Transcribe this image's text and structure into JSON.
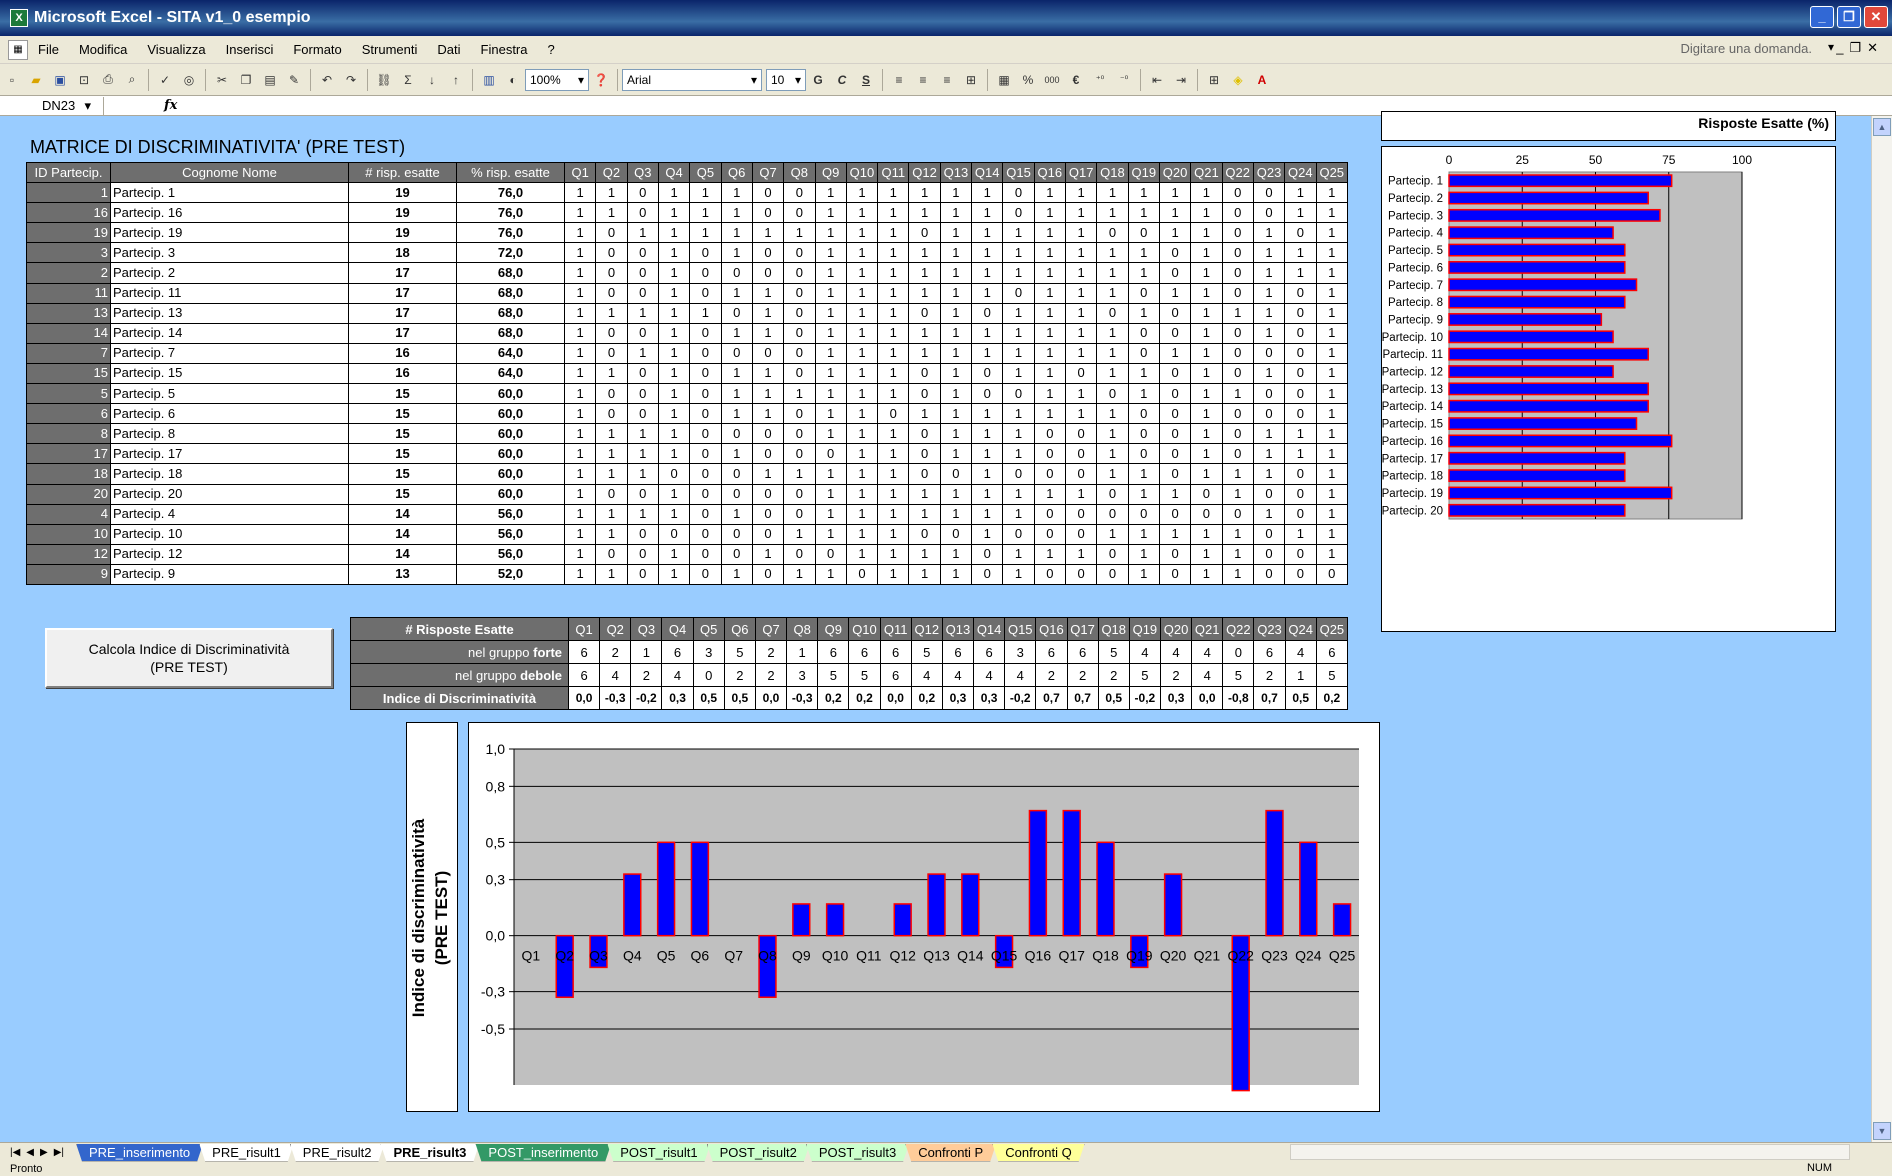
{
  "window": {
    "title": "Microsoft Excel - SITA v1_0 esempio",
    "help_placeholder": "Digitare una domanda."
  },
  "menu": [
    "File",
    "Modifica",
    "Visualizza",
    "Inserisci",
    "Formato",
    "Strumenti",
    "Dati",
    "Finestra",
    "?"
  ],
  "toolbar": {
    "zoom": "100%",
    "font": "Arial",
    "size": "10",
    "bold": "G",
    "italic": "C",
    "underline": "S",
    "percent": "%",
    "thousands": "000",
    "euro": "€"
  },
  "formula": {
    "cell_ref": "DN23",
    "fx": "fx",
    "value": ""
  },
  "sheet_title": "MATRICE DI DISCRIMINATIVITA' (PRE TEST)",
  "matrix": {
    "headers": [
      "ID Partecip.",
      "Cognome Nome",
      "# risp. esatte",
      "% risp. esatte",
      "Q1",
      "Q2",
      "Q3",
      "Q4",
      "Q5",
      "Q6",
      "Q7",
      "Q8",
      "Q9",
      "Q10",
      "Q11",
      "Q12",
      "Q13",
      "Q14",
      "Q15",
      "Q16",
      "Q17",
      "Q18",
      "Q19",
      "Q20",
      "Q21",
      "Q22",
      "Q23",
      "Q24",
      "Q25"
    ],
    "rows": [
      {
        "id": "1",
        "name": "Partecip. 1",
        "n": "19",
        "pct": "76,0",
        "q": [
          1,
          1,
          0,
          1,
          1,
          1,
          0,
          0,
          1,
          1,
          1,
          1,
          1,
          1,
          0,
          1,
          1,
          1,
          1,
          1,
          1,
          0,
          0,
          1,
          1
        ]
      },
      {
        "id": "16",
        "name": "Partecip. 16",
        "n": "19",
        "pct": "76,0",
        "q": [
          1,
          1,
          0,
          1,
          1,
          1,
          0,
          0,
          1,
          1,
          1,
          1,
          1,
          1,
          0,
          1,
          1,
          1,
          1,
          1,
          1,
          0,
          0,
          1,
          1
        ]
      },
      {
        "id": "19",
        "name": "Partecip. 19",
        "n": "19",
        "pct": "76,0",
        "q": [
          1,
          0,
          1,
          1,
          1,
          1,
          1,
          1,
          1,
          1,
          1,
          0,
          1,
          1,
          1,
          1,
          1,
          0,
          0,
          1,
          1,
          0,
          1,
          0,
          1
        ]
      },
      {
        "id": "3",
        "name": "Partecip. 3",
        "n": "18",
        "pct": "72,0",
        "q": [
          1,
          0,
          0,
          1,
          0,
          1,
          0,
          0,
          1,
          1,
          1,
          1,
          1,
          1,
          1,
          1,
          1,
          1,
          1,
          0,
          1,
          0,
          1,
          1,
          1
        ]
      },
      {
        "id": "2",
        "name": "Partecip. 2",
        "n": "17",
        "pct": "68,0",
        "q": [
          1,
          0,
          0,
          1,
          0,
          0,
          0,
          0,
          1,
          1,
          1,
          1,
          1,
          1,
          1,
          1,
          1,
          1,
          1,
          0,
          1,
          0,
          1,
          1,
          1
        ]
      },
      {
        "id": "11",
        "name": "Partecip. 11",
        "n": "17",
        "pct": "68,0",
        "q": [
          1,
          0,
          0,
          1,
          0,
          1,
          1,
          0,
          1,
          1,
          1,
          1,
          1,
          1,
          0,
          1,
          1,
          1,
          0,
          1,
          1,
          0,
          1,
          0,
          1
        ]
      },
      {
        "id": "13",
        "name": "Partecip. 13",
        "n": "17",
        "pct": "68,0",
        "q": [
          1,
          1,
          1,
          1,
          1,
          0,
          1,
          0,
          1,
          1,
          1,
          0,
          1,
          0,
          1,
          1,
          1,
          0,
          1,
          0,
          1,
          1,
          1,
          0,
          1
        ]
      },
      {
        "id": "14",
        "name": "Partecip. 14",
        "n": "17",
        "pct": "68,0",
        "q": [
          1,
          0,
          0,
          1,
          0,
          1,
          1,
          0,
          1,
          1,
          1,
          1,
          1,
          1,
          1,
          1,
          1,
          1,
          0,
          0,
          1,
          0,
          1,
          0,
          1
        ]
      },
      {
        "id": "7",
        "name": "Partecip. 7",
        "n": "16",
        "pct": "64,0",
        "q": [
          1,
          0,
          1,
          1,
          0,
          0,
          0,
          0,
          1,
          1,
          1,
          1,
          1,
          1,
          1,
          1,
          1,
          1,
          0,
          1,
          1,
          0,
          0,
          0,
          1
        ]
      },
      {
        "id": "15",
        "name": "Partecip. 15",
        "n": "16",
        "pct": "64,0",
        "q": [
          1,
          1,
          0,
          1,
          0,
          1,
          1,
          0,
          1,
          1,
          1,
          0,
          1,
          0,
          1,
          1,
          0,
          1,
          1,
          0,
          1,
          0,
          1,
          0,
          1
        ]
      },
      {
        "id": "5",
        "name": "Partecip. 5",
        "n": "15",
        "pct": "60,0",
        "q": [
          1,
          0,
          0,
          1,
          0,
          1,
          1,
          1,
          1,
          1,
          1,
          0,
          1,
          0,
          0,
          1,
          1,
          0,
          1,
          0,
          1,
          1,
          0,
          0,
          1
        ]
      },
      {
        "id": "6",
        "name": "Partecip. 6",
        "n": "15",
        "pct": "60,0",
        "q": [
          1,
          0,
          0,
          1,
          0,
          1,
          1,
          0,
          1,
          1,
          0,
          1,
          1,
          1,
          1,
          1,
          1,
          1,
          0,
          0,
          1,
          0,
          0,
          0,
          1
        ]
      },
      {
        "id": "8",
        "name": "Partecip. 8",
        "n": "15",
        "pct": "60,0",
        "q": [
          1,
          1,
          1,
          1,
          0,
          0,
          0,
          0,
          1,
          1,
          1,
          0,
          1,
          1,
          1,
          0,
          0,
          1,
          0,
          0,
          1,
          0,
          1,
          1,
          1
        ]
      },
      {
        "id": "17",
        "name": "Partecip. 17",
        "n": "15",
        "pct": "60,0",
        "q": [
          1,
          1,
          1,
          1,
          0,
          1,
          0,
          0,
          0,
          1,
          1,
          0,
          1,
          1,
          1,
          0,
          0,
          1,
          0,
          0,
          1,
          0,
          1,
          1,
          1
        ]
      },
      {
        "id": "18",
        "name": "Partecip. 18",
        "n": "15",
        "pct": "60,0",
        "q": [
          1,
          1,
          1,
          0,
          0,
          0,
          1,
          1,
          1,
          1,
          1,
          0,
          0,
          1,
          0,
          0,
          0,
          1,
          1,
          0,
          1,
          1,
          1,
          0,
          1
        ]
      },
      {
        "id": "20",
        "name": "Partecip. 20",
        "n": "15",
        "pct": "60,0",
        "q": [
          1,
          0,
          0,
          1,
          0,
          0,
          0,
          0,
          1,
          1,
          1,
          1,
          1,
          1,
          1,
          1,
          1,
          0,
          1,
          1,
          0,
          1,
          0,
          0,
          1
        ]
      },
      {
        "id": "4",
        "name": "Partecip. 4",
        "n": "14",
        "pct": "56,0",
        "q": [
          1,
          1,
          1,
          1,
          0,
          1,
          0,
          0,
          1,
          1,
          1,
          1,
          1,
          1,
          1,
          0,
          0,
          0,
          0,
          0,
          0,
          0,
          1,
          0,
          1
        ]
      },
      {
        "id": "10",
        "name": "Partecip. 10",
        "n": "14",
        "pct": "56,0",
        "q": [
          1,
          1,
          0,
          0,
          0,
          0,
          0,
          1,
          1,
          1,
          1,
          0,
          0,
          1,
          0,
          0,
          0,
          1,
          1,
          1,
          1,
          1,
          0,
          1,
          1
        ]
      },
      {
        "id": "12",
        "name": "Partecip. 12",
        "n": "14",
        "pct": "56,0",
        "q": [
          1,
          0,
          0,
          1,
          0,
          0,
          1,
          0,
          0,
          1,
          1,
          1,
          1,
          0,
          1,
          1,
          1,
          0,
          1,
          0,
          1,
          1,
          0,
          0,
          1
        ]
      },
      {
        "id": "9",
        "name": "Partecip. 9",
        "n": "13",
        "pct": "52,0",
        "q": [
          1,
          1,
          0,
          1,
          0,
          1,
          0,
          1,
          1,
          0,
          1,
          1,
          1,
          0,
          1,
          0,
          0,
          0,
          1,
          0,
          1,
          1,
          0,
          0,
          0
        ]
      }
    ]
  },
  "calc_button": {
    "line1": "Calcola Indice di Discriminatività",
    "line2": "(PRE TEST)"
  },
  "stats": {
    "header": "# Risposte Esatte",
    "q_labels": [
      "Q1",
      "Q2",
      "Q3",
      "Q4",
      "Q5",
      "Q6",
      "Q7",
      "Q8",
      "Q9",
      "Q10",
      "Q11",
      "Q12",
      "Q13",
      "Q14",
      "Q15",
      "Q16",
      "Q17",
      "Q18",
      "Q19",
      "Q20",
      "Q21",
      "Q22",
      "Q23",
      "Q24",
      "Q25"
    ],
    "forte_label": "nel gruppo",
    "forte_bold": "forte",
    "forte": [
      6,
      2,
      1,
      6,
      3,
      5,
      2,
      1,
      6,
      6,
      6,
      5,
      6,
      6,
      3,
      6,
      6,
      5,
      4,
      4,
      4,
      0,
      6,
      4,
      6
    ],
    "debole_label": "nel gruppo",
    "debole_bold": "debole",
    "debole": [
      6,
      4,
      2,
      4,
      0,
      2,
      2,
      3,
      5,
      5,
      6,
      4,
      4,
      4,
      4,
      2,
      2,
      2,
      5,
      2,
      4,
      5,
      2,
      1,
      5
    ],
    "index_label": "Indice di Discriminatività",
    "index": [
      "0,0",
      "-0,3",
      "-0,2",
      "0,3",
      "0,5",
      "0,5",
      "0,0",
      "-0,3",
      "0,2",
      "0,2",
      "0,0",
      "0,2",
      "0,3",
      "0,3",
      "-0,2",
      "0,7",
      "0,7",
      "0,5",
      "-0,2",
      "0,3",
      "0,0",
      "-0,8",
      "0,7",
      "0,5",
      "0,2"
    ]
  },
  "chart_data": [
    {
      "type": "bar",
      "orientation": "horizontal",
      "title": "Risposte Esatte (%)",
      "categories": [
        "Partecip. 1",
        "Partecip. 2",
        "Partecip. 3",
        "Partecip. 4",
        "Partecip. 5",
        "Partecip. 6",
        "Partecip. 7",
        "Partecip. 8",
        "Partecip. 9",
        "Partecip. 10",
        "Partecip. 11",
        "Partecip. 12",
        "Partecip. 13",
        "Partecip. 14",
        "Partecip. 15",
        "Partecip. 16",
        "Partecip. 17",
        "Partecip. 18",
        "Partecip. 19",
        "Partecip. 20"
      ],
      "values": [
        76,
        68,
        72,
        56,
        60,
        60,
        64,
        60,
        52,
        56,
        68,
        56,
        68,
        68,
        64,
        76,
        60,
        60,
        76,
        60
      ],
      "xlim": [
        0,
        100
      ],
      "ticks": [
        "0",
        "25",
        "50",
        "75",
        "100"
      ],
      "bar_fill": "#0000ff",
      "bar_stroke": "#ff0000",
      "plot_bg": "#c0c0c0"
    },
    {
      "type": "bar",
      "ylabel_line1": "Indice di discriminatività",
      "ylabel_line2": "(PRE TEST)",
      "categories": [
        "Q1",
        "Q2",
        "Q3",
        "Q4",
        "Q5",
        "Q6",
        "Q7",
        "Q8",
        "Q9",
        "Q10",
        "Q11",
        "Q12",
        "Q13",
        "Q14",
        "Q15",
        "Q16",
        "Q17",
        "Q18",
        "Q19",
        "Q20",
        "Q21",
        "Q22",
        "Q23",
        "Q24",
        "Q25"
      ],
      "values": [
        0,
        -0.33,
        -0.17,
        0.33,
        0.5,
        0.5,
        0,
        -0.33,
        0.17,
        0.17,
        0,
        0.17,
        0.33,
        0.33,
        -0.17,
        0.67,
        0.67,
        0.5,
        -0.17,
        0.33,
        0,
        -0.83,
        0.67,
        0.5,
        0.17
      ],
      "ylim": [
        -0.8,
        1.0
      ],
      "yticks": [
        1.0,
        0.8,
        0.5,
        0.3,
        0.0,
        -0.3,
        -0.5
      ],
      "ytick_labels": [
        "1,0",
        "0,8",
        "0,5",
        "0,3",
        "0,0",
        "-0,3",
        "-0,5"
      ],
      "bar_fill": "#0000ff",
      "bar_stroke": "#ff0000",
      "plot_bg": "#c0c0c0"
    }
  ],
  "sheet_tabs": [
    {
      "label": "PRE_inserimento",
      "style": "blue"
    },
    {
      "label": "PRE_risult1",
      "style": "white"
    },
    {
      "label": "PRE_risult2",
      "style": "white"
    },
    {
      "label": "PRE_risult3",
      "style": "active"
    },
    {
      "label": "POST_inserimento",
      "style": "green"
    },
    {
      "label": "POST_risult1",
      "style": "lgreen"
    },
    {
      "label": "POST_risult2",
      "style": "lgreen"
    },
    {
      "label": "POST_risult3",
      "style": "lgreen"
    },
    {
      "label": "Confronti P",
      "style": "orange"
    },
    {
      "label": "Confronti Q",
      "style": "yellow"
    }
  ],
  "status": {
    "left": "Pronto",
    "right": "NUM"
  }
}
